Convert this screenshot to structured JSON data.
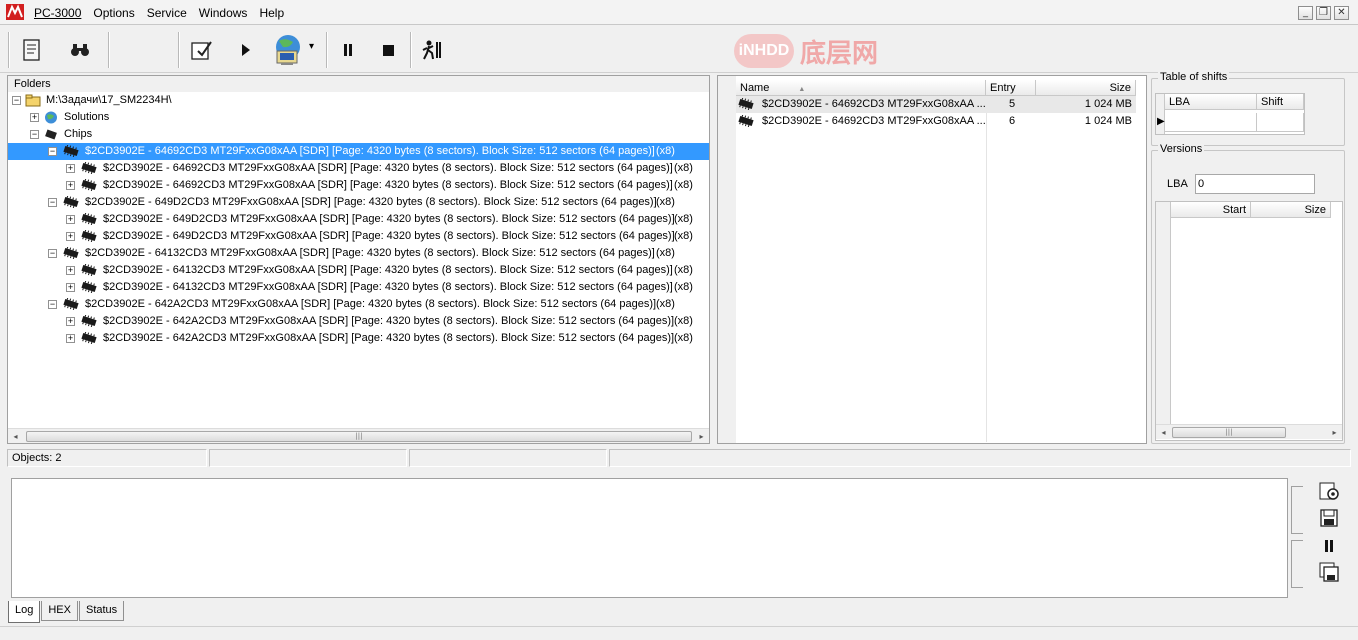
{
  "window": {
    "title": "PC-3000",
    "menu": [
      {
        "label": "Options",
        "accel": ""
      },
      {
        "label": "Service",
        "accel": ""
      },
      {
        "label": "Windows",
        "accel": "W"
      },
      {
        "label": "Help",
        "accel": "H"
      }
    ],
    "controls": {
      "minimize": "_",
      "restore": "❐",
      "close": "✕"
    }
  },
  "toolbar": {
    "icons": [
      "log-icon",
      "binoculars-icon",
      "task-icon",
      "play-icon",
      "network-computer-icon",
      "pause-icon",
      "stop-icon",
      "exit-icon"
    ],
    "glyphs": {
      "log": "📜",
      "binoculars": "⚲",
      "task": "✎",
      "play": "▶",
      "network": "🖧",
      "dropdown": "▾",
      "pause": "⏸",
      "stop": "■",
      "exit": "🚶"
    }
  },
  "watermark": {
    "badge": "iNHDD",
    "text": "底层网"
  },
  "folders": {
    "header": "Folders",
    "root": "M:\\Задачи\\17_SM2234H\\",
    "solutions": "Solutions",
    "chips": "Chips",
    "items": [
      {
        "level": 1,
        "text": "$2CD3902E -  64692CD3 MT29FxxG08xAA [SDR] [Page: 4320 bytes (8 sectors). Block Size: 512 sectors (64 pages)]",
        "count": "(x8)",
        "selected": true,
        "exp": "−"
      },
      {
        "level": 2,
        "text": "$2CD3902E -  64692CD3 MT29FxxG08xAA [SDR] [Page: 4320 bytes (8 sectors). Block Size: 512 sectors (64 pages)]",
        "count": "(x8)",
        "selected": false,
        "exp": "+"
      },
      {
        "level": 2,
        "text": "$2CD3902E -  64692CD3 MT29FxxG08xAA [SDR] [Page: 4320 bytes (8 sectors). Block Size: 512 sectors (64 pages)]",
        "count": "(x8)",
        "selected": false,
        "exp": "+"
      },
      {
        "level": 1,
        "text": "$2CD3902E -  649D2CD3 MT29FxxG08xAA [SDR] [Page: 4320 bytes (8 sectors). Block Size: 512 sectors (64 pages)]",
        "count": "(x8)",
        "selected": false,
        "exp": "−"
      },
      {
        "level": 2,
        "text": "$2CD3902E -  649D2CD3 MT29FxxG08xAA [SDR] [Page: 4320 bytes (8 sectors). Block Size: 512 sectors (64 pages)]",
        "count": "(x8)",
        "selected": false,
        "exp": "+"
      },
      {
        "level": 2,
        "text": "$2CD3902E -  649D2CD3 MT29FxxG08xAA [SDR] [Page: 4320 bytes (8 sectors). Block Size: 512 sectors (64 pages)]",
        "count": "(x8)",
        "selected": false,
        "exp": "+"
      },
      {
        "level": 1,
        "text": "$2CD3902E -  64132CD3 MT29FxxG08xAA [SDR] [Page: 4320 bytes (8 sectors). Block Size: 512 sectors (64 pages)]",
        "count": "(x8)",
        "selected": false,
        "exp": "−"
      },
      {
        "level": 2,
        "text": "$2CD3902E -  64132CD3 MT29FxxG08xAA [SDR] [Page: 4320 bytes (8 sectors). Block Size: 512 sectors (64 pages)]",
        "count": "(x8)",
        "selected": false,
        "exp": "+"
      },
      {
        "level": 2,
        "text": "$2CD3902E -  64132CD3 MT29FxxG08xAA [SDR] [Page: 4320 bytes (8 sectors). Block Size: 512 sectors (64 pages)]",
        "count": "(x8)",
        "selected": false,
        "exp": "+"
      },
      {
        "level": 1,
        "text": "$2CD3902E -  642A2CD3 MT29FxxG08xAA [SDR] [Page: 4320 bytes (8 sectors). Block Size: 512 sectors (64 pages)]",
        "count": "(x8)",
        "selected": false,
        "exp": "−"
      },
      {
        "level": 2,
        "text": "$2CD3902E -  642A2CD3 MT29FxxG08xAA [SDR] [Page: 4320 bytes (8 sectors). Block Size: 512 sectors (64 pages)]",
        "count": "(x8)",
        "selected": false,
        "exp": "+"
      },
      {
        "level": 2,
        "text": "$2CD3902E -  642A2CD3 MT29FxxG08xAA [SDR] [Page: 4320 bytes (8 sectors). Block Size: 512 sectors (64 pages)]",
        "count": "(x8)",
        "selected": false,
        "exp": "+"
      }
    ]
  },
  "entries": {
    "columns": [
      "Name",
      "Entry",
      "Size"
    ],
    "sort_glyph": "▲",
    "rows": [
      {
        "name": "$2CD3902E -  64692CD3 MT29FxxG08xAA ...",
        "entry": "5",
        "size": "1 024 MB"
      },
      {
        "name": "$2CD3902E -  64692CD3 MT29FxxG08xAA ...",
        "entry": "6",
        "size": "1 024 MB"
      }
    ]
  },
  "shifts": {
    "title": "Table of shifts",
    "columns": [
      "LBA",
      "Shift"
    ]
  },
  "versions": {
    "title": "Versions",
    "lba_label": "LBA",
    "lba_value": "0",
    "columns": [
      "Start",
      "Size"
    ]
  },
  "status": {
    "objects": "Objects: 2"
  },
  "tabs": [
    "Log",
    "HEX",
    "Status"
  ],
  "scroll": {
    "left": "◂",
    "right": "▸",
    "thumb": "|||"
  }
}
